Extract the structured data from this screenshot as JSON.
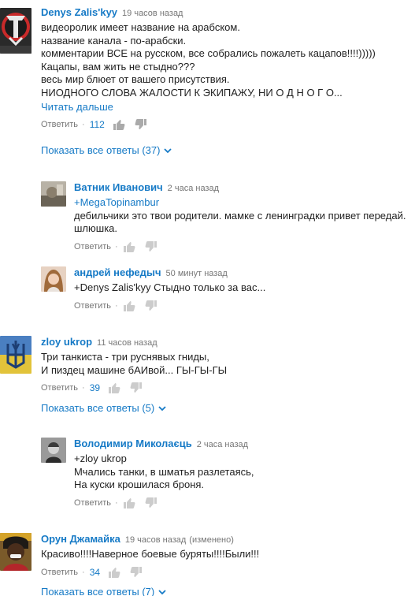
{
  "comments": [
    {
      "author": "Denys Zalis'kyy",
      "time": "19 часов назад",
      "lines": [
        "видеоролик имеет название на арабском.",
        "название канала - по-арабски.",
        "комментарии ВСЕ на русском, все собрались пожалеть кацапов!!!!)))))",
        "Кацапы, вам жить не стыдно???",
        "весь мир блюет от вашего присутствия.",
        "НИОДНОГО СЛОВА ЖАЛОСТИ К ЭКИПАЖУ, НИ О Д Н О Г О..."
      ],
      "read_more": "Читать дальше",
      "reply": "Ответить",
      "likes": "112",
      "show_all": "Показать все ответы (37)"
    },
    {
      "author": "Ватник Иванович",
      "time": "2 часа назад",
      "mention": "+MegaTopinambur",
      "lines": [
        "дебильчики это твои родители. мамке с ленинградки привет передай.",
        "шлюшка."
      ],
      "reply": "Ответить"
    },
    {
      "author": "андрей нефедыч",
      "time": "50 минут назад",
      "lines": [
        "+Denys Zalis'kyy Стыдно только за вас..."
      ],
      "reply": "Ответить"
    },
    {
      "author": "zloy ukrop",
      "time": "11 часов назад",
      "lines": [
        "Три танкиста - три руснявых гниды,",
        "И пиздец машине бАИвой... ГЫ-ГЫ-ГЫ"
      ],
      "reply": "Ответить",
      "likes": "39",
      "show_all": "Показать все ответы (5)"
    },
    {
      "author": "Володимир Миколаєць",
      "time": "2 часа назад",
      "lines": [
        "+zloy ukrop",
        "Мчались танки, в шматья разлетаясь,",
        "На куски крошилася броня."
      ],
      "reply": "Ответить"
    },
    {
      "author": "Орун Джамайка",
      "time": "19 часов назад",
      "edited": "(изменено)",
      "lines": [
        "Красиво!!!!Наверное боевые буряты!!!!Были!!!"
      ],
      "reply": "Ответить",
      "likes": "34",
      "show_all": "Показать все ответы (7)"
    }
  ],
  "icons": {
    "like": "thumbs-up-icon",
    "dislike": "thumbs-down-icon",
    "chevron": "chevron-down-icon"
  },
  "colors": {
    "link": "#167ac6",
    "meta": "#767676",
    "text": "#222222"
  }
}
